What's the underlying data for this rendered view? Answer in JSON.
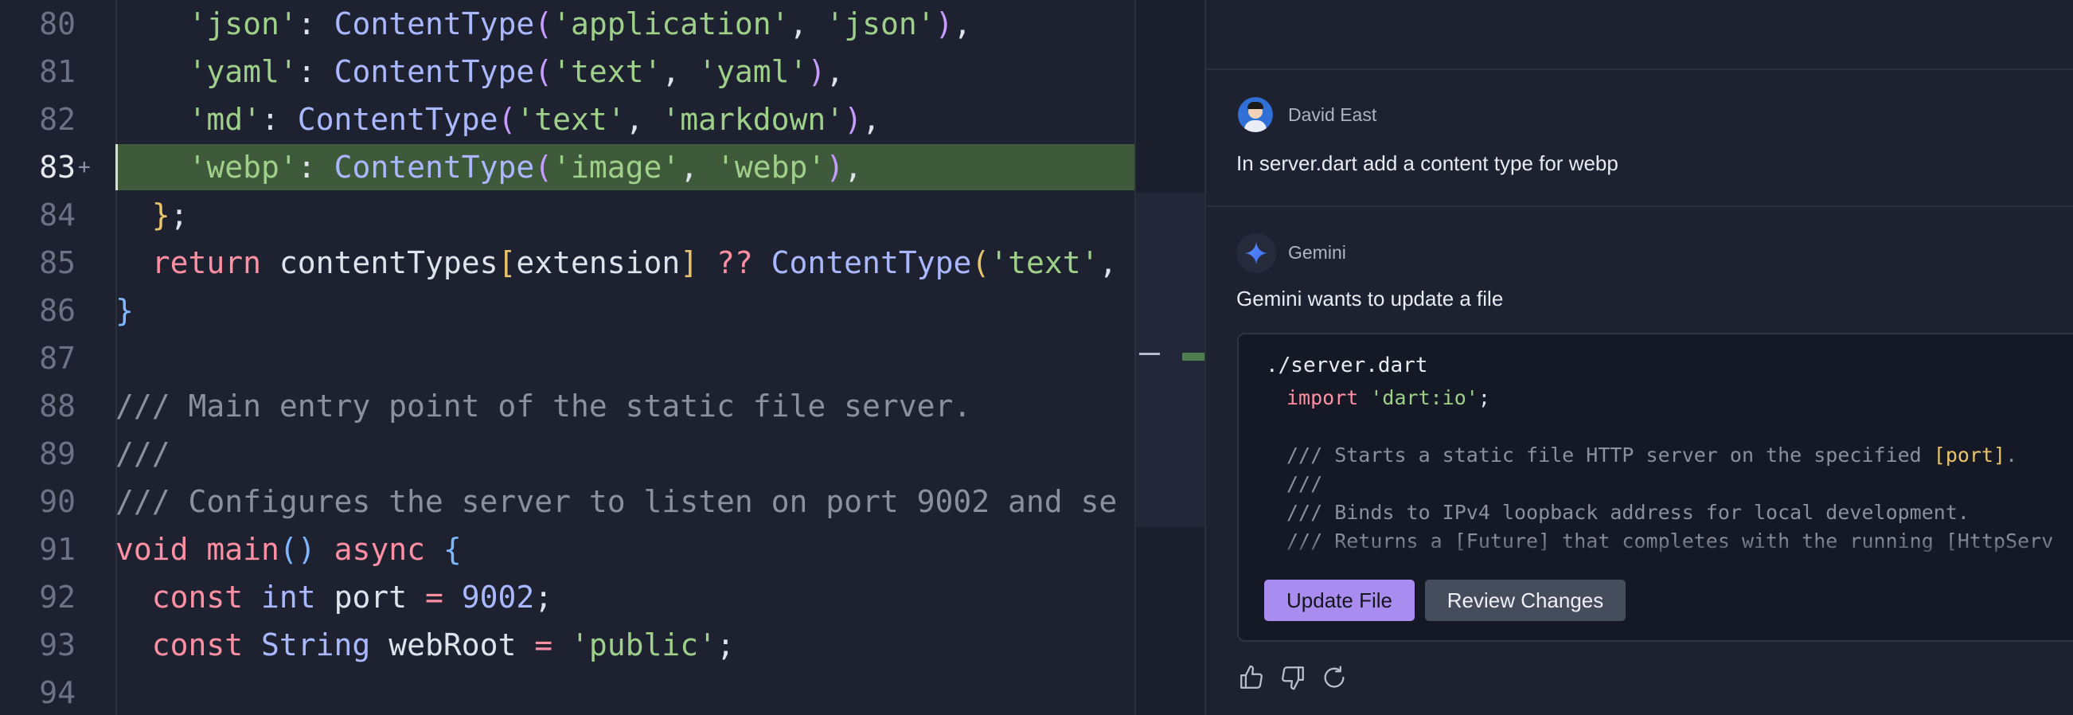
{
  "editor": {
    "lines": [
      {
        "num": "80",
        "marker": "",
        "tokens": [
          {
            "t": "    ",
            "c": "punc"
          },
          {
            "t": "'json'",
            "c": "str"
          },
          {
            "t": ": ",
            "c": "punc"
          },
          {
            "t": "ContentType",
            "c": "type"
          },
          {
            "t": "(",
            "c": "br2"
          },
          {
            "t": "'application'",
            "c": "str"
          },
          {
            "t": ", ",
            "c": "punc"
          },
          {
            "t": "'json'",
            "c": "str"
          },
          {
            "t": ")",
            "c": "br2"
          },
          {
            "t": ",",
            "c": "punc"
          }
        ]
      },
      {
        "num": "81",
        "marker": "",
        "tokens": [
          {
            "t": "    ",
            "c": "punc"
          },
          {
            "t": "'yaml'",
            "c": "str"
          },
          {
            "t": ": ",
            "c": "punc"
          },
          {
            "t": "ContentType",
            "c": "type"
          },
          {
            "t": "(",
            "c": "br2"
          },
          {
            "t": "'text'",
            "c": "str"
          },
          {
            "t": ", ",
            "c": "punc"
          },
          {
            "t": "'yaml'",
            "c": "str"
          },
          {
            "t": ")",
            "c": "br2"
          },
          {
            "t": ",",
            "c": "punc"
          }
        ]
      },
      {
        "num": "82",
        "marker": "",
        "tokens": [
          {
            "t": "    ",
            "c": "punc"
          },
          {
            "t": "'md'",
            "c": "str"
          },
          {
            "t": ": ",
            "c": "punc"
          },
          {
            "t": "ContentType",
            "c": "type"
          },
          {
            "t": "(",
            "c": "br2"
          },
          {
            "t": "'text'",
            "c": "str"
          },
          {
            "t": ", ",
            "c": "punc"
          },
          {
            "t": "'markdown'",
            "c": "str"
          },
          {
            "t": ")",
            "c": "br2"
          },
          {
            "t": ",",
            "c": "punc"
          }
        ]
      },
      {
        "num": "83",
        "marker": "+",
        "active": true,
        "tokens": [
          {
            "t": "    ",
            "c": "punc"
          },
          {
            "t": "'webp'",
            "c": "str"
          },
          {
            "t": ": ",
            "c": "punc"
          },
          {
            "t": "ContentType",
            "c": "type"
          },
          {
            "t": "(",
            "c": "br2"
          },
          {
            "t": "'image'",
            "c": "str"
          },
          {
            "t": ", ",
            "c": "punc"
          },
          {
            "t": "'webp'",
            "c": "str"
          },
          {
            "t": ")",
            "c": "br2"
          },
          {
            "t": ",",
            "c": "punc"
          }
        ]
      },
      {
        "num": "84",
        "marker": "",
        "tokens": [
          {
            "t": "  ",
            "c": "punc"
          },
          {
            "t": "}",
            "c": "br1"
          },
          {
            "t": ";",
            "c": "punc"
          }
        ]
      },
      {
        "num": "85",
        "marker": "",
        "tokens": [
          {
            "t": "  ",
            "c": "punc"
          },
          {
            "t": "return",
            "c": "kw"
          },
          {
            "t": " contentTypes",
            "c": "punc"
          },
          {
            "t": "[",
            "c": "br1"
          },
          {
            "t": "extension",
            "c": "punc"
          },
          {
            "t": "]",
            "c": "br1"
          },
          {
            "t": " ?? ",
            "c": "kw"
          },
          {
            "t": "ContentType",
            "c": "type"
          },
          {
            "t": "(",
            "c": "br1"
          },
          {
            "t": "'text'",
            "c": "str"
          },
          {
            "t": ",",
            "c": "punc"
          }
        ]
      },
      {
        "num": "86",
        "marker": "",
        "tokens": [
          {
            "t": "}",
            "c": "br3"
          }
        ]
      },
      {
        "num": "87",
        "marker": "",
        "tokens": []
      },
      {
        "num": "88",
        "marker": "",
        "tokens": [
          {
            "t": "/// Main entry point of the static file server.",
            "c": "cmt"
          }
        ]
      },
      {
        "num": "89",
        "marker": "",
        "tokens": [
          {
            "t": "///",
            "c": "cmt"
          }
        ]
      },
      {
        "num": "90",
        "marker": "",
        "tokens": [
          {
            "t": "/// Configures the server to listen on port 9002 and se",
            "c": "cmt"
          }
        ]
      },
      {
        "num": "91",
        "marker": "",
        "tokens": [
          {
            "t": "void",
            "c": "kw"
          },
          {
            "t": " ",
            "c": "punc"
          },
          {
            "t": "main",
            "c": "kw"
          },
          {
            "t": "()",
            "c": "br3"
          },
          {
            "t": " ",
            "c": "punc"
          },
          {
            "t": "async",
            "c": "kw"
          },
          {
            "t": " ",
            "c": "punc"
          },
          {
            "t": "{",
            "c": "br3"
          }
        ]
      },
      {
        "num": "92",
        "marker": "",
        "tokens": [
          {
            "t": "  ",
            "c": "punc"
          },
          {
            "t": "const",
            "c": "kw"
          },
          {
            "t": " ",
            "c": "punc"
          },
          {
            "t": "int",
            "c": "type"
          },
          {
            "t": " port ",
            "c": "punc"
          },
          {
            "t": "=",
            "c": "kw"
          },
          {
            "t": " ",
            "c": "punc"
          },
          {
            "t": "9002",
            "c": "num"
          },
          {
            "t": ";",
            "c": "punc"
          }
        ]
      },
      {
        "num": "93",
        "marker": "",
        "tokens": [
          {
            "t": "  ",
            "c": "punc"
          },
          {
            "t": "const",
            "c": "kw"
          },
          {
            "t": " ",
            "c": "punc"
          },
          {
            "t": "String",
            "c": "type"
          },
          {
            "t": " webRoot ",
            "c": "punc"
          },
          {
            "t": "=",
            "c": "kw"
          },
          {
            "t": " ",
            "c": "punc"
          },
          {
            "t": "'public'",
            "c": "str"
          },
          {
            "t": ";",
            "c": "punc"
          }
        ]
      },
      {
        "num": "94",
        "marker": "",
        "tokens": []
      }
    ]
  },
  "chat": {
    "user_message": {
      "sender": "David East",
      "text": "In server.dart add a content type for webp"
    },
    "gemini_message": {
      "sender": "Gemini",
      "text": "Gemini wants to update a file",
      "file_card": {
        "path": "./server.dart",
        "snippet": [
          {
            "tokens": [
              {
                "t": "import",
                "c": "kw"
              },
              {
                "t": " ",
                "c": "punc"
              },
              {
                "t": "'dart:io'",
                "c": "str"
              },
              {
                "t": ";",
                "c": "punc"
              }
            ]
          },
          {
            "tokens": []
          },
          {
            "tokens": [
              {
                "t": "/// Starts a static file HTTP server on the specified ",
                "c": "cmt"
              },
              {
                "t": "[port]",
                "c": "br1"
              },
              {
                "t": ".",
                "c": "cmt"
              }
            ]
          },
          {
            "tokens": [
              {
                "t": "///",
                "c": "cmt"
              }
            ]
          },
          {
            "tokens": [
              {
                "t": "/// Binds to IPv4 loopback address for local development.",
                "c": "cmt"
              }
            ]
          },
          {
            "tokens": [
              {
                "t": "/// Returns a [Future] that completes with the running [HttpServ",
                "c": "cmt"
              }
            ]
          }
        ],
        "update_button": "Update File",
        "review_button": "Review Changes"
      }
    },
    "feedback_icons": [
      "thumbs-up-icon",
      "thumbs-down-icon",
      "refresh-icon"
    ]
  },
  "colors": {
    "accent_button": "#a98cf0",
    "highlight_added_line": "#3e5a3b",
    "background": "#1e2230"
  }
}
